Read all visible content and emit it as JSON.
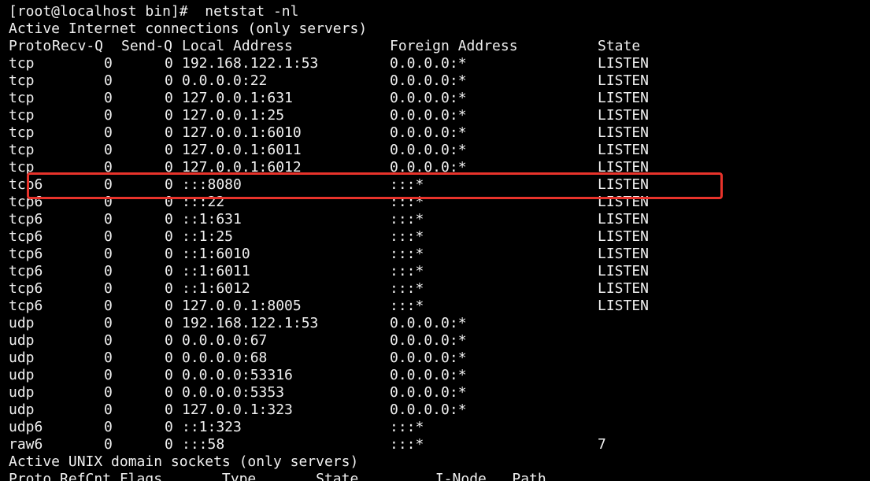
{
  "terminal": {
    "prompt_line": "[root@localhost bin]#  netstat -nl",
    "section_inet": "Active Internet connections (only servers)",
    "inet_header": {
      "proto": "Proto",
      "recvq": "Recv-Q",
      "sendq": "Send-Q",
      "local": "Local Address",
      "foreign": "Foreign Address",
      "state": "State"
    },
    "rows": [
      {
        "proto": "tcp",
        "recvq": "0",
        "sendq": "0",
        "local": "192.168.122.1:53",
        "foreign": "0.0.0.0:*",
        "state": "LISTEN"
      },
      {
        "proto": "tcp",
        "recvq": "0",
        "sendq": "0",
        "local": "0.0.0.0:22",
        "foreign": "0.0.0.0:*",
        "state": "LISTEN"
      },
      {
        "proto": "tcp",
        "recvq": "0",
        "sendq": "0",
        "local": "127.0.0.1:631",
        "foreign": "0.0.0.0:*",
        "state": "LISTEN"
      },
      {
        "proto": "tcp",
        "recvq": "0",
        "sendq": "0",
        "local": "127.0.0.1:25",
        "foreign": "0.0.0.0:*",
        "state": "LISTEN"
      },
      {
        "proto": "tcp",
        "recvq": "0",
        "sendq": "0",
        "local": "127.0.0.1:6010",
        "foreign": "0.0.0.0:*",
        "state": "LISTEN"
      },
      {
        "proto": "tcp",
        "recvq": "0",
        "sendq": "0",
        "local": "127.0.0.1:6011",
        "foreign": "0.0.0.0:*",
        "state": "LISTEN"
      },
      {
        "proto": "tcp",
        "recvq": "0",
        "sendq": "0",
        "local": "127.0.0.1:6012",
        "foreign": "0.0.0.0:*",
        "state": "LISTEN"
      },
      {
        "proto": "tcp6",
        "recvq": "0",
        "sendq": "0",
        "local": ":::8080",
        "foreign": ":::*",
        "state": "LISTEN"
      },
      {
        "proto": "tcp6",
        "recvq": "0",
        "sendq": "0",
        "local": ":::22",
        "foreign": ":::*",
        "state": "LISTEN"
      },
      {
        "proto": "tcp6",
        "recvq": "0",
        "sendq": "0",
        "local": "::1:631",
        "foreign": ":::*",
        "state": "LISTEN"
      },
      {
        "proto": "tcp6",
        "recvq": "0",
        "sendq": "0",
        "local": "::1:25",
        "foreign": ":::*",
        "state": "LISTEN"
      },
      {
        "proto": "tcp6",
        "recvq": "0",
        "sendq": "0",
        "local": "::1:6010",
        "foreign": ":::*",
        "state": "LISTEN"
      },
      {
        "proto": "tcp6",
        "recvq": "0",
        "sendq": "0",
        "local": "::1:6011",
        "foreign": ":::*",
        "state": "LISTEN"
      },
      {
        "proto": "tcp6",
        "recvq": "0",
        "sendq": "0",
        "local": "::1:6012",
        "foreign": ":::*",
        "state": "LISTEN"
      },
      {
        "proto": "tcp6",
        "recvq": "0",
        "sendq": "0",
        "local": "127.0.0.1:8005",
        "foreign": ":::*",
        "state": "LISTEN"
      },
      {
        "proto": "udp",
        "recvq": "0",
        "sendq": "0",
        "local": "192.168.122.1:53",
        "foreign": "0.0.0.0:*",
        "state": ""
      },
      {
        "proto": "udp",
        "recvq": "0",
        "sendq": "0",
        "local": "0.0.0.0:67",
        "foreign": "0.0.0.0:*",
        "state": ""
      },
      {
        "proto": "udp",
        "recvq": "0",
        "sendq": "0",
        "local": "0.0.0.0:68",
        "foreign": "0.0.0.0:*",
        "state": ""
      },
      {
        "proto": "udp",
        "recvq": "0",
        "sendq": "0",
        "local": "0.0.0.0:53316",
        "foreign": "0.0.0.0:*",
        "state": ""
      },
      {
        "proto": "udp",
        "recvq": "0",
        "sendq": "0",
        "local": "0.0.0.0:5353",
        "foreign": "0.0.0.0:*",
        "state": ""
      },
      {
        "proto": "udp",
        "recvq": "0",
        "sendq": "0",
        "local": "127.0.0.1:323",
        "foreign": "0.0.0.0:*",
        "state": ""
      },
      {
        "proto": "udp6",
        "recvq": "0",
        "sendq": "0",
        "local": "::1:323",
        "foreign": ":::*",
        "state": ""
      },
      {
        "proto": "raw6",
        "recvq": "0",
        "sendq": "0",
        "local": ":::58",
        "foreign": ":::*",
        "state": "7"
      }
    ],
    "section_unix": "Active UNIX domain sockets (only servers)",
    "unix_header": "Proto RefCnt Flags       Type       State         I-Node   Path",
    "highlight_color": "#e8332b",
    "highlighted_row_index": 7
  }
}
